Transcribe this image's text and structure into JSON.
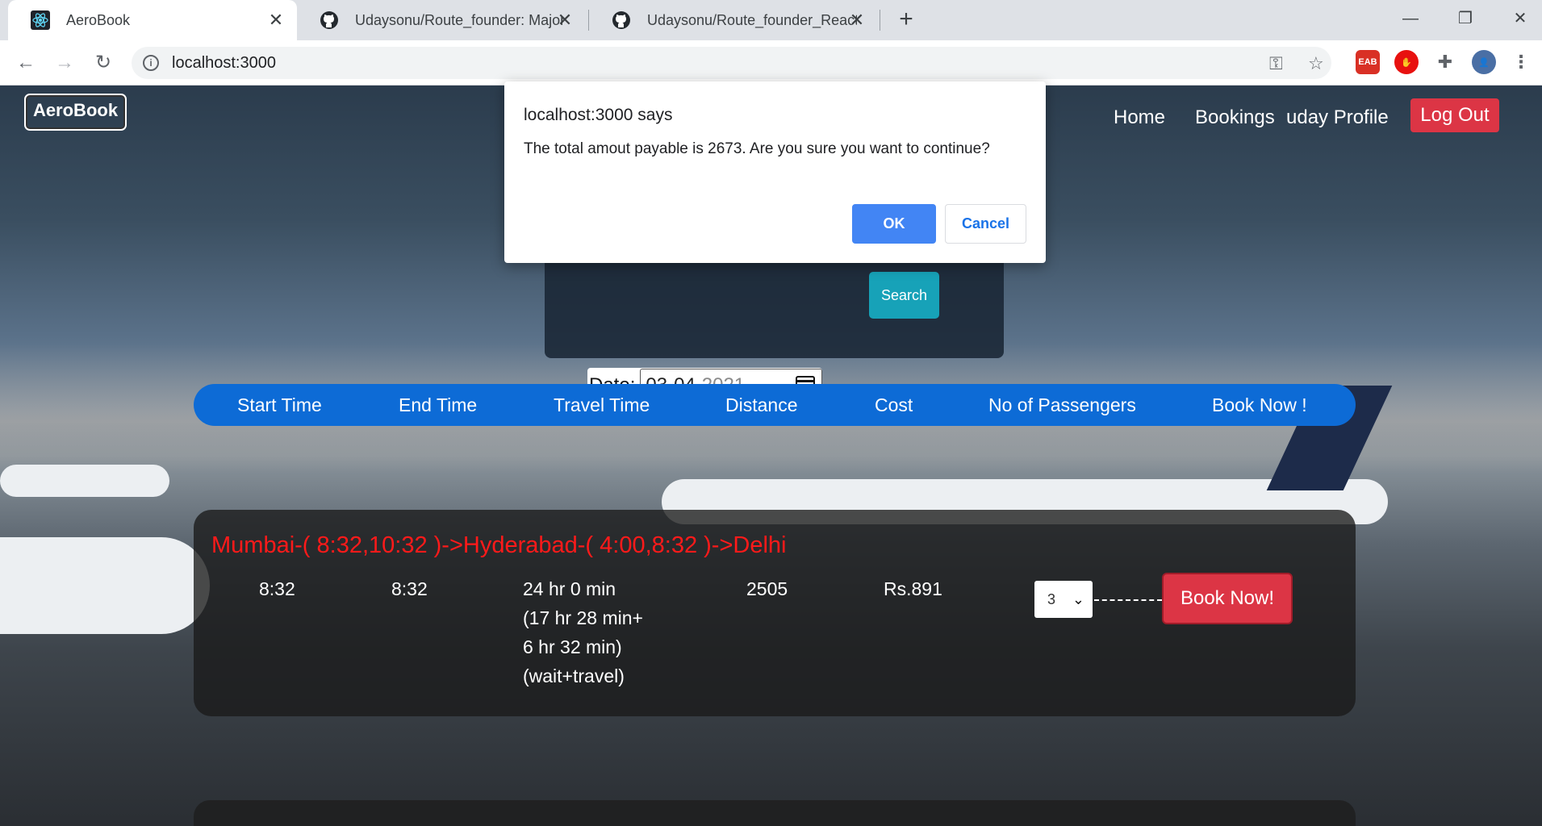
{
  "browser": {
    "tabs": [
      {
        "title": "AeroBook",
        "favicon": "react-icon",
        "active": true
      },
      {
        "title": "Udaysonu/Route_founder: Major",
        "favicon": "github-icon",
        "active": false
      },
      {
        "title": "Udaysonu/Route_founder_React_",
        "favicon": "github-icon",
        "active": false
      }
    ],
    "url": "localhost:3000",
    "extensions": [
      {
        "name": "eab-extension-icon",
        "label": "EAB",
        "color": "#d93025"
      },
      {
        "name": "adblock-extension-icon",
        "label": "",
        "color": "#e8110f"
      }
    ]
  },
  "app": {
    "brand": "AeroBook",
    "nav": {
      "home": "Home",
      "bookings": "Bookings",
      "profile": "uday Profile",
      "logout": "Log Out"
    },
    "search": {
      "date_label": "Date:",
      "date_day_month": "03-04-",
      "date_year": "2021",
      "search_button": "Search"
    },
    "table_headers": [
      "Start Time",
      "End Time",
      "Travel Time",
      "Distance",
      "Cost",
      "No of Passengers",
      "Book Now !"
    ],
    "result": {
      "route": "Mumbai-( 8:32,10:32 )->Hyderabad-( 4:00,8:32 )->Delhi",
      "start_time": "8:32",
      "end_time": "8:32",
      "travel_time_lines": [
        "24 hr 0 min",
        "(17 hr 28 min+",
        "6 hr 32 min)",
        "(wait+travel)"
      ],
      "distance": "2505",
      "cost": "Rs.891",
      "passengers": "3",
      "book_button": "Book Now!"
    }
  },
  "dialog": {
    "title": "localhost:3000 says",
    "message": "The total amout payable is 2673. Are you sure you want to continue?",
    "ok": "OK",
    "cancel": "Cancel"
  },
  "colors": {
    "header_bar": "#0d6bd6",
    "danger": "#dc3545",
    "route_text": "#ff1a1a",
    "search_button": "#17a2b8",
    "dialog_ok": "#4285f4"
  }
}
